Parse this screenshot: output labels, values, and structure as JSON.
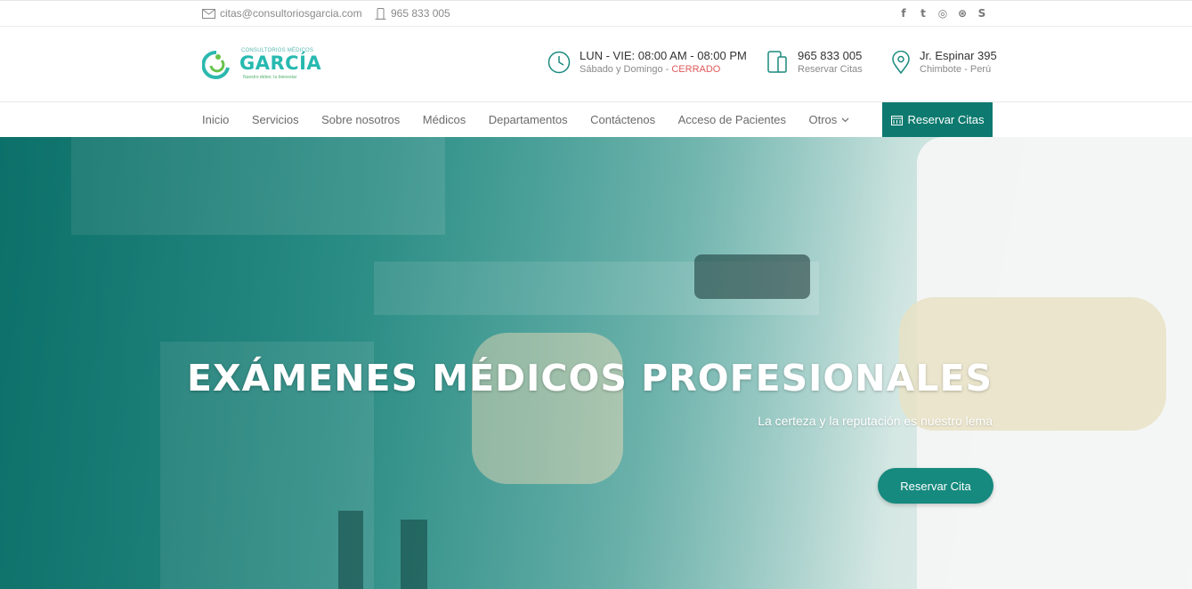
{
  "topbar": {
    "email": "citas@consultoriosgarcia.com",
    "phone": "965 833 005",
    "social": [
      {
        "icon": "facebook-icon",
        "glyph": "f"
      },
      {
        "icon": "twitter-icon",
        "glyph": "t"
      },
      {
        "icon": "instagram-icon",
        "glyph": "◎"
      },
      {
        "icon": "dribbble-icon",
        "glyph": "⊛"
      },
      {
        "icon": "skype-icon",
        "glyph": "S"
      }
    ]
  },
  "logo": {
    "small": "CONSULTORIOS MÉDICOS",
    "name": "GARCÍA",
    "tag": "Nuestro deber, tu bienestar"
  },
  "header": {
    "hours_title": "LUN - VIE: 08:00 AM - 08:00 PM",
    "hours_sub": "Sábado y Domingo - ",
    "hours_closed": "CERRADO",
    "phone_title": "965 833 005",
    "phone_sub": "Reservar Citas",
    "address_title": "Jr. Espinar 395",
    "address_sub": "Chimbote - Perú"
  },
  "nav": {
    "items": [
      "Inicio",
      "Servicios",
      "Sobre nosotros",
      "Médicos",
      "Departamentos",
      "Contáctenos",
      "Acceso de Pacientes",
      "Otros"
    ],
    "reserve_label": "Reservar Citas"
  },
  "hero": {
    "title": "EXÁMENES MÉDICOS PROFESIONALES",
    "subtitle": "La certeza y la reputación es nuestro lema",
    "button": "Reservar Cita"
  },
  "colors": {
    "accent": "#0e7a6f",
    "brand": "#27b9b0",
    "closed": "#e05a5a"
  }
}
